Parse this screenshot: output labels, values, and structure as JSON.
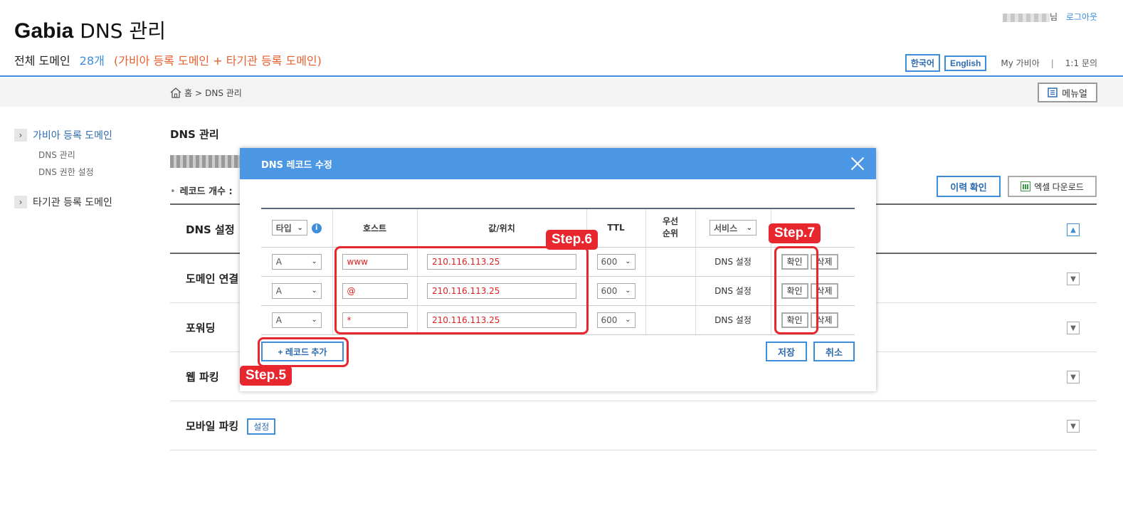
{
  "header": {
    "brand_bold": "Gabia",
    "brand_rest": " DNS 관리",
    "summary_label": "전체 도메인",
    "summary_count": "28개",
    "summary_note": "(가비아 등록 도메인 + 타기관 등록 도메인)",
    "user_suffix": "님",
    "logout": "로그아웃",
    "lang_ko": "한국어",
    "lang_en": "English",
    "my_gabia": "My 가비아",
    "separator": "|",
    "inquiry": "1:1 문의"
  },
  "breadcrumb": {
    "home": "홈",
    "sep": ">",
    "current": "DNS 관리",
    "manual": "메뉴얼"
  },
  "sidebar": {
    "groups": [
      {
        "label": "가비아 등록 도메인",
        "subs": [
          "DNS 관리",
          "DNS 권한 설정"
        ]
      },
      {
        "label": "타기관 등록 도메인"
      }
    ]
  },
  "main": {
    "title": "DNS 관리",
    "record_count_label": "레코드 개수 :",
    "history_btn": "이력 확인",
    "excel_btn": "엑셀 다운로드",
    "setting_badge": "설정",
    "sections": [
      {
        "title": "DNS 설정"
      },
      {
        "title": "도메인 연결"
      },
      {
        "title": "포워딩"
      },
      {
        "title": "웹 파킹"
      },
      {
        "title": "모바일 파킹"
      }
    ]
  },
  "modal": {
    "title": "DNS 레코드 수정",
    "headers": {
      "type": "타입",
      "host": "호스트",
      "value": "값/위치",
      "ttl": "TTL",
      "priority": "우선\n순위",
      "service": "서비스"
    },
    "rows": [
      {
        "type": "A",
        "host": "www",
        "value": "210.116.113.25",
        "ttl": "600",
        "service": "DNS 설정",
        "confirm": "확인",
        "delete": "삭제"
      },
      {
        "type": "A",
        "host": "@",
        "value": "210.116.113.25",
        "ttl": "600",
        "service": "DNS 설정",
        "confirm": "확인",
        "delete": "삭제"
      },
      {
        "type": "A",
        "host": "*",
        "value": "210.116.113.25",
        "ttl": "600",
        "service": "DNS 설정",
        "confirm": "확인",
        "delete": "삭제"
      }
    ],
    "add_record": "+ 레코드 추가",
    "save": "저장",
    "cancel": "취소"
  },
  "annotations": {
    "step5": "Step.5",
    "step6": "Step.6",
    "step7": "Step.7"
  },
  "colors": {
    "accent": "#3d8ddb",
    "modal_header": "#4b97e3",
    "annotation": "#e8262e",
    "note": "#e86030"
  }
}
